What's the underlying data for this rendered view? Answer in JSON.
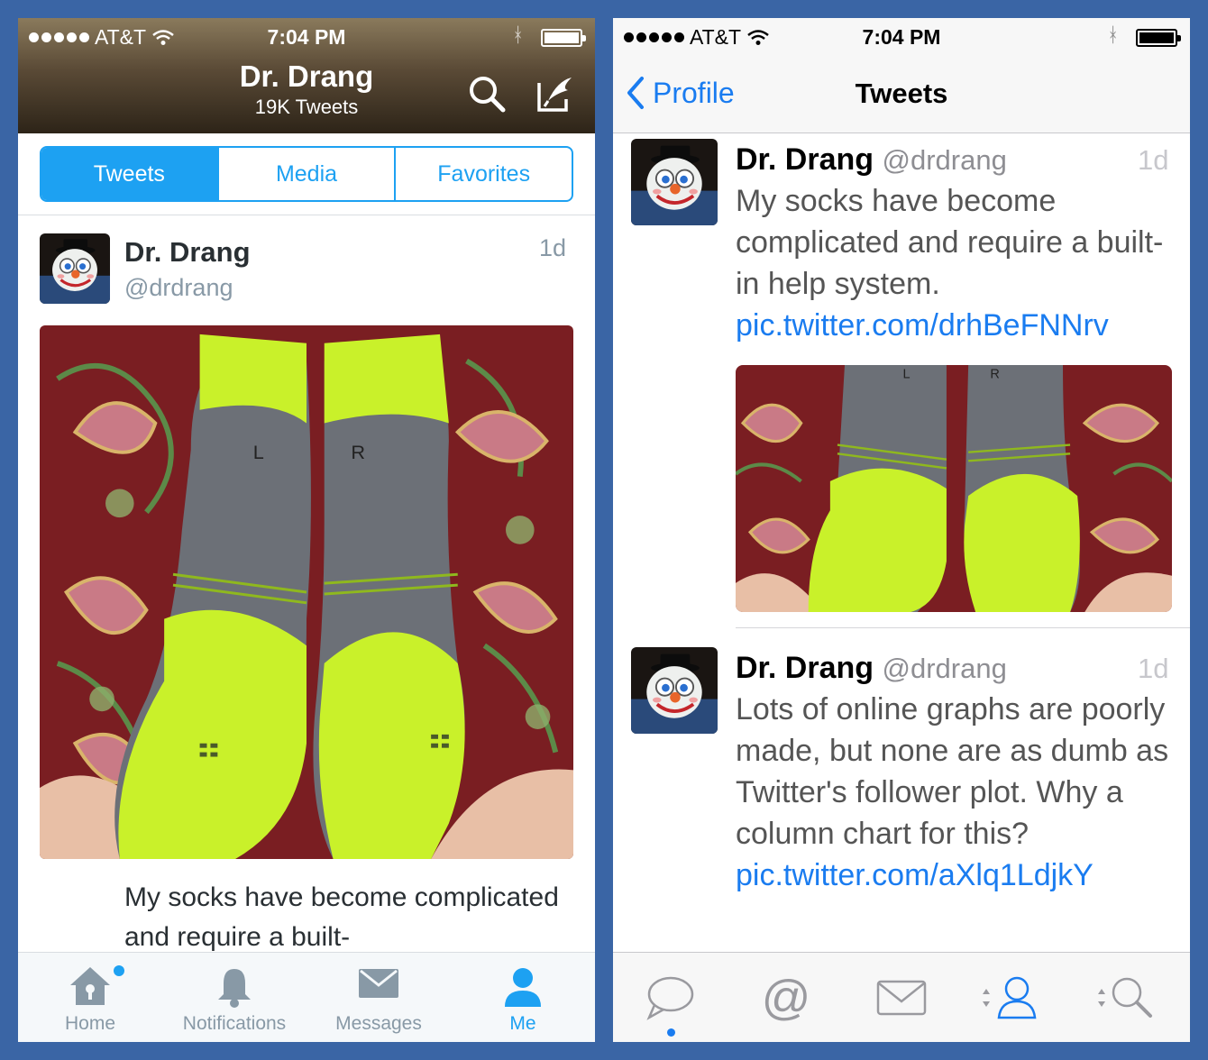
{
  "left": {
    "status": {
      "carrier": "AT&T",
      "time": "7:04 PM"
    },
    "header": {
      "title": "Dr. Drang",
      "subtitle": "19K Tweets",
      "search_icon": "search-icon",
      "compose_icon": "compose-icon"
    },
    "tabs": [
      {
        "label": "Tweets",
        "active": true
      },
      {
        "label": "Media",
        "active": false
      },
      {
        "label": "Favorites",
        "active": false
      }
    ],
    "tweet": {
      "name": "Dr. Drang",
      "handle": "@drdrang",
      "time": "1d",
      "text": "My socks have become complicated and require a built-"
    },
    "tabbar": [
      {
        "label": "Home",
        "icon": "home-icon",
        "badge": true
      },
      {
        "label": "Notifications",
        "icon": "bell-icon"
      },
      {
        "label": "Messages",
        "icon": "envelope-icon"
      },
      {
        "label": "Me",
        "icon": "person-icon",
        "active": true
      }
    ]
  },
  "right": {
    "status": {
      "carrier": "AT&T",
      "time": "7:04 PM"
    },
    "nav": {
      "back_label": "Profile",
      "title": "Tweets"
    },
    "tweets": [
      {
        "name": "Dr. Drang",
        "handle": "@drdrang",
        "time": "1d",
        "text": "My socks have become complicated and require a built-in help system.",
        "link": "pic.twitter.com/drhBeFNNrv"
      },
      {
        "name": "Dr. Drang",
        "handle": "@drdrang",
        "time": "1d",
        "text": "Lots of online graphs are poorly made, but none are as dumb as Twitter's follower plot. Why a column chart for this?",
        "link": "pic.twitter.com/aXlq1LdjkY"
      }
    ],
    "tabbar": [
      {
        "icon": "speech-bubble-icon",
        "active": true
      },
      {
        "icon": "at-sign-icon"
      },
      {
        "icon": "envelope-icon"
      },
      {
        "icon": "person-icon"
      },
      {
        "icon": "search-icon"
      }
    ]
  },
  "colors": {
    "background": "#3a65a5",
    "twitter_blue": "#1da1f2",
    "tweetbot_blue": "#1a7cf0",
    "sock_yellow": "#c9f12a"
  }
}
